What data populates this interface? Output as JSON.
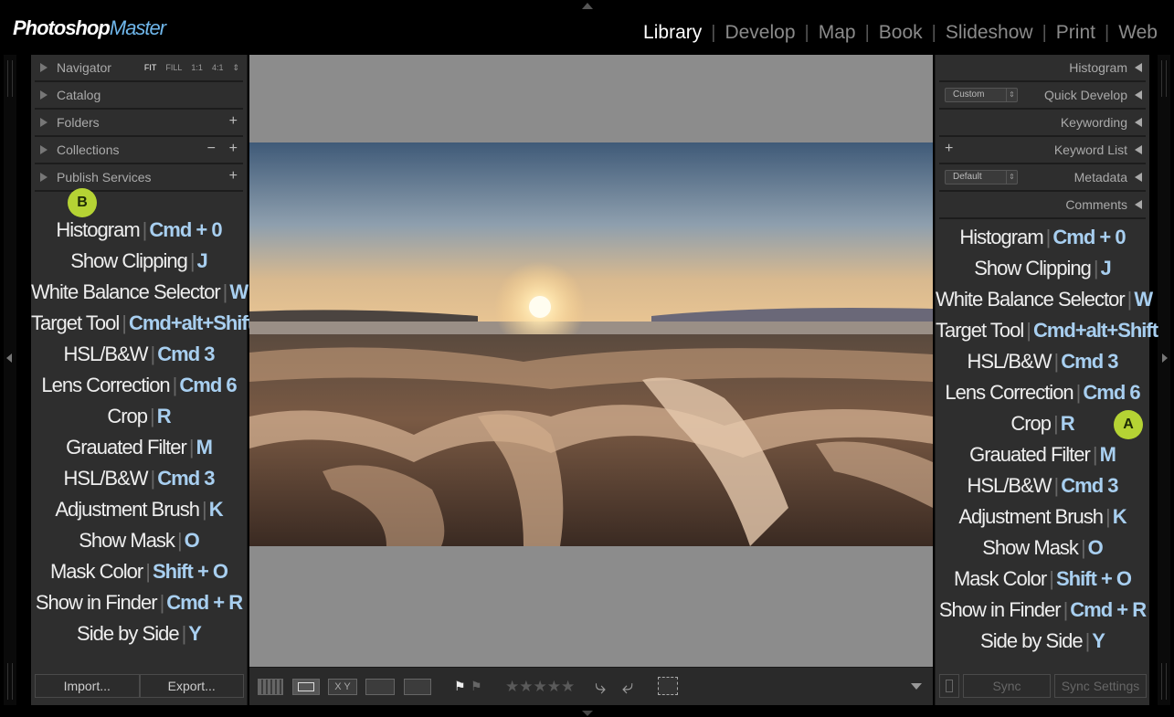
{
  "logo": {
    "part1": "Photoshop",
    "part2": "Master"
  },
  "modules": [
    "Library",
    "Develop",
    "Map",
    "Book",
    "Slideshow",
    "Print",
    "Web"
  ],
  "active_module": "Library",
  "left_panels": {
    "navigator": {
      "label": "Navigator",
      "options": [
        "FIT",
        "FILL",
        "1:1",
        "4:1"
      ]
    },
    "catalog": "Catalog",
    "folders": "Folders",
    "collections": "Collections",
    "publish": "Publish Services"
  },
  "right_panels": {
    "histogram": "Histogram",
    "quick_develop": {
      "label": "Quick Develop",
      "preset": "Custom"
    },
    "keywording": "Keywording",
    "keyword_list": "Keyword List",
    "metadata": {
      "label": "Metadata",
      "preset": "Default"
    },
    "comments": "Comments"
  },
  "badges": {
    "left": "B",
    "right": "A"
  },
  "shortcuts": [
    {
      "action": "Histogram",
      "key": "Cmd + 0"
    },
    {
      "action": "Show Clipping",
      "key": "J"
    },
    {
      "action": "White Balance Selector",
      "key": "W"
    },
    {
      "action": "Target Tool",
      "key": "Cmd+alt+Shift"
    },
    {
      "action": "HSL/B&W",
      "key": "Cmd 3"
    },
    {
      "action": "Lens Correction",
      "key": "Cmd 6"
    },
    {
      "action": "Crop",
      "key": "R"
    },
    {
      "action": "Grauated Filter",
      "key": "M"
    },
    {
      "action": "HSL/B&W",
      "key": "Cmd 3"
    },
    {
      "action": "Adjustment Brush",
      "key": "K"
    },
    {
      "action": "Show Mask",
      "key": "O"
    },
    {
      "action": "Mask Color",
      "key": "Shift + O"
    },
    {
      "action": "Show in Finder",
      "key": "Cmd + R"
    },
    {
      "action": "Side by Side",
      "key": "Y"
    }
  ],
  "buttons": {
    "import": "Import...",
    "export": "Export...",
    "sync": "Sync",
    "sync_settings": "Sync Settings"
  },
  "toolbar": {
    "stars": "★★★★★",
    "compare_label": "X Y"
  },
  "colors": {
    "accent_blue": "#a8cff0",
    "badge": "#b5d334",
    "panel": "#2e2e2e",
    "center_bg": "#8c8c8c"
  }
}
